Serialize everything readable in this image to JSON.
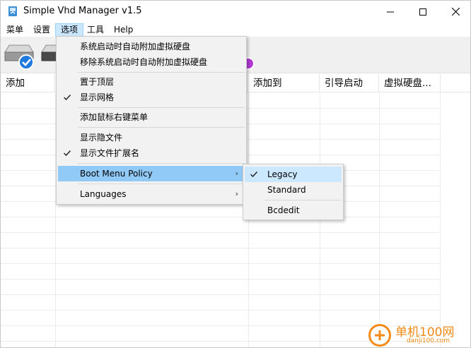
{
  "window": {
    "title": "Simple Vhd Manager v1.5",
    "controls": {
      "minimize": "minimize-icon",
      "maximize": "maximize-icon",
      "close": "close-icon"
    }
  },
  "menubar": {
    "items": [
      {
        "label": "菜单"
      },
      {
        "label": "设置"
      },
      {
        "label": "选项",
        "active": true
      },
      {
        "label": "工具"
      },
      {
        "label": "Help"
      }
    ]
  },
  "toolbar": {
    "buttons": [
      {
        "icon": "disk-add-check-icon"
      },
      {
        "icon": "disk-icon"
      },
      {
        "icon": "disk-purple-icon"
      }
    ]
  },
  "list": {
    "columns": [
      "添加",
      "",
      "添加到",
      "引导启动",
      "虚拟硬盘..."
    ]
  },
  "options_menu": {
    "items": [
      {
        "label": "系统启动时自动附加虚拟硬盘",
        "checked": false
      },
      {
        "label": "移除系统启动时自动附加虚拟硬盘",
        "checked": false
      },
      {
        "label": "置于顶层",
        "checked": false
      },
      {
        "label": "显示网格",
        "checked": true
      },
      {
        "label": "添加鼠标右键菜单",
        "checked": false
      },
      {
        "label": "显示隐文件",
        "checked": false
      },
      {
        "label": "显示文件扩展名",
        "checked": true
      },
      {
        "label": "Boot Menu Policy",
        "submenu": true,
        "highlighted": true
      },
      {
        "label": "Languages",
        "submenu": true
      }
    ],
    "submenu_arrow": "›"
  },
  "boot_policy_submenu": {
    "items": [
      {
        "label": "Legacy",
        "checked": true
      },
      {
        "label": "Standard",
        "checked": false
      },
      {
        "label": "Bcdedit",
        "checked": false
      }
    ]
  },
  "watermark": {
    "name": "单机100网",
    "domain": "danji100.com"
  },
  "colors": {
    "menu_highlight": "#91c9f7",
    "menubar_active": "#cce8ff",
    "check_color": "#1a5fb4",
    "watermark": "#f08a16"
  }
}
